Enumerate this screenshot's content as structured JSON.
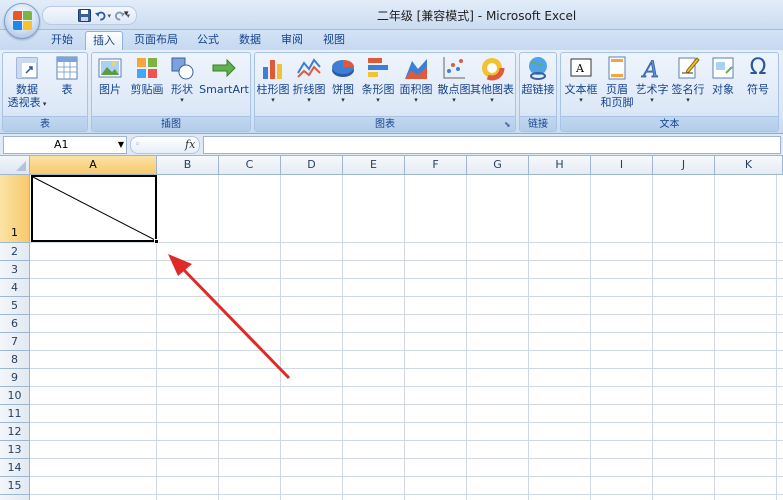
{
  "window": {
    "title": "二年级  [兼容模式] - Microsoft Excel"
  },
  "quick_access": {
    "items": [
      "save-icon",
      "undo-icon",
      "redo-icon"
    ],
    "more": "▾"
  },
  "tabs": [
    {
      "label": "开始",
      "active": false
    },
    {
      "label": "插入",
      "active": true
    },
    {
      "label": "页面布局",
      "active": false
    },
    {
      "label": "公式",
      "active": false
    },
    {
      "label": "数据",
      "active": false
    },
    {
      "label": "审阅",
      "active": false
    },
    {
      "label": "视图",
      "active": false
    }
  ],
  "ribbon": {
    "groups": {
      "tables": "表",
      "illustrations": "插图",
      "charts": "图表",
      "links": "链接",
      "text": "文本"
    },
    "buttons": {
      "pivot_line1": "数据",
      "pivot_line2": "透视表",
      "table": "表",
      "picture": "图片",
      "clipart": "剪贴画",
      "shapes": "形状",
      "smartart": "SmartArt",
      "column_chart": "柱形图",
      "line_chart": "折线图",
      "pie_chart": "饼图",
      "bar_chart": "条形图",
      "area_chart": "面积图",
      "scatter_chart": "散点图",
      "other_charts": "其他图表",
      "hyperlink": "超链接",
      "textbox": "文本框",
      "header_footer_line1": "页眉",
      "header_footer_line2": "和页脚",
      "wordart": "艺术字",
      "signature": "签名行",
      "object": "对象",
      "symbol": "符号"
    }
  },
  "formula_bar": {
    "name_box": "A1",
    "fx": "fx",
    "formula": ""
  },
  "grid": {
    "columns": [
      "A",
      "B",
      "C",
      "D",
      "E",
      "F",
      "G",
      "H",
      "I",
      "J",
      "K"
    ],
    "rows": [
      "1",
      "2",
      "3",
      "4",
      "5",
      "6",
      "7",
      "8",
      "9",
      "10",
      "11",
      "12",
      "13",
      "14",
      "15"
    ],
    "selected_cell": "A1",
    "cell_a1_content": "diagonal-line"
  },
  "annotation": {
    "type": "red-arrow",
    "color": "#e02a2a"
  },
  "colors": {
    "accent": "#15428b",
    "selection_header": "#f7c96a",
    "arrow": "#e02a2a"
  }
}
